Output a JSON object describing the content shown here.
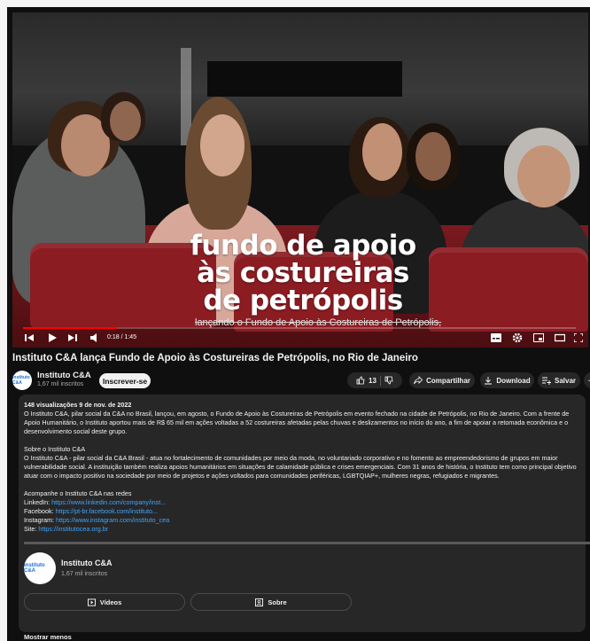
{
  "video": {
    "overlay_caption": [
      "fundo de apoio",
      "às costureiras",
      "de petrópolis"
    ],
    "subtitle": "lançando o Fundo de Apoio às Costureiras de Petrópolis,",
    "time": "0:18 / 1:45",
    "progress": 0.17
  },
  "title": "Instituto C&A lança Fundo de Apoio às Costureiras de Petrópolis, no Rio de Janeiro",
  "channel": {
    "name": "Instituto C&A",
    "subscribers": "1,67 mil inscritos",
    "avatar_text": "instituto C&A"
  },
  "actions": {
    "subscribe": "Inscrever-se",
    "likes": "13",
    "share": "Compartilhar",
    "download": "Download",
    "save": "Salvar",
    "more": "···"
  },
  "description": {
    "meta": "148 visualizações  9 de nov. de 2022",
    "para1": "O Instituto C&A, pilar social da C&A no Brasil, lançou, em agosto, o Fundo de Apoio às Costureiras de Petrópolis em evento fechado na cidade de Petrópolis, no Rio de Janeiro. Com a frente de Apoio Humanitário, o Instituto aportou mais de R$ 65 mil em ações voltadas a 52 costureiras afetadas pelas chuvas e deslizamentos no início do ano, a fim de apoiar a retomada econômica e o desenvolvimento social deste grupo.",
    "about_heading": "Sobre o Instituto C&A",
    "para2": "O Instituto C&A - pilar social da C&A Brasil - atua no fortalecimento de comunidades por meio da moda, no voluntariado corporativo e no fomento ao empreendedorismo de grupos em maior vulnerabilidade social. A instituição também realiza apoios humanitários em situações de calamidade pública e crises emergenciais. Com 31 anos de história, o Instituto tem como principal objetivo atuar com o impacto positivo na sociedade por meio de projetos e ações voltados para comunidades periféricas, LGBTQIAP+, mulheres negras, refugiados e migrantes.",
    "follow_heading": "Acompanhe o Instituto C&A nas redes",
    "links": [
      {
        "label": "LinkedIn:",
        "url": "https://www.linkedin.com/company/inst..."
      },
      {
        "label": "Facebook:",
        "url": "https://pt-br.facebook.com/instituto..."
      },
      {
        "label": "Instagram:",
        "url": "https://www.instagram.com/instituto_cea"
      },
      {
        "label": "Site:",
        "url": "https://institutocea.org.br"
      }
    ],
    "card_name": "Instituto C&A",
    "card_subs": "1,67 mil inscritos",
    "videos_btn": "Vídeos",
    "about_btn": "Sobre",
    "show_less": "Mostrar menos"
  },
  "colors": {
    "accent": "#ff0000",
    "link": "#3ea6ff",
    "background": "#0f0f0f",
    "panel": "#272727"
  }
}
